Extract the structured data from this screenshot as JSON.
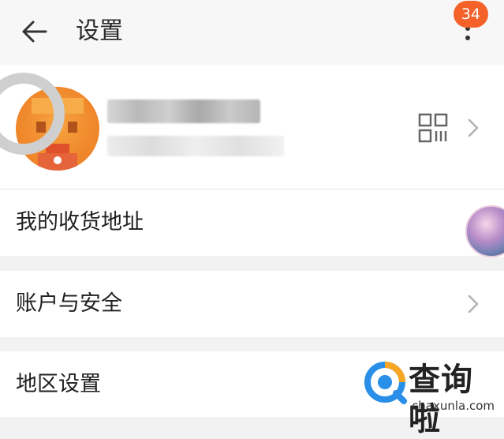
{
  "header": {
    "title": "设置",
    "back_icon": "arrow-left-icon",
    "more_icon": "more-vertical-icon",
    "badge_count": "34",
    "badge_color": "#f4622a"
  },
  "profile": {
    "avatar": "pixelated-avatar",
    "qr_icon": "qr-code-icon",
    "chevron_icon": "chevron-right-icon"
  },
  "settings": {
    "items": [
      {
        "label": "我的收货地址"
      },
      {
        "label": "账户与安全",
        "chevron_icon": "chevron-right-icon"
      },
      {
        "label": "地区设置"
      }
    ]
  },
  "watermark": {
    "brand": "查询啦",
    "url": "chaxunla.com"
  }
}
